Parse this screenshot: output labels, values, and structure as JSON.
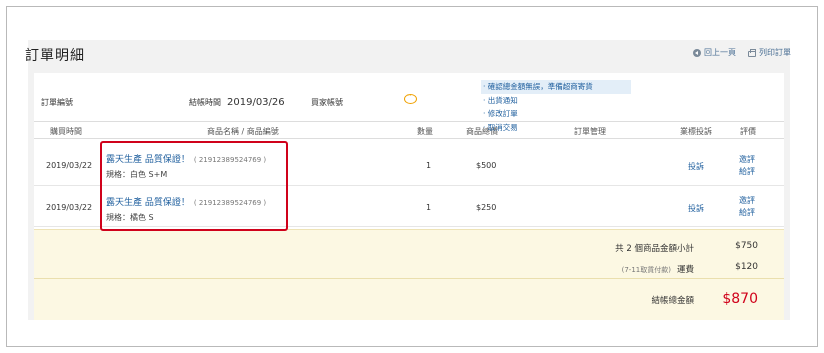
{
  "header": {
    "title": "訂單明細",
    "back_label": "回上一頁",
    "print_label": "列印訂單"
  },
  "order": {
    "number_label": "訂單編號",
    "checkout_time_label": "結帳時間",
    "checkout_time": "2019/03/26",
    "buyer_label": "買家帳號"
  },
  "table": {
    "headers": [
      "購買時間",
      "商品名稱 / 商品編號",
      "數量",
      "商品總價",
      "訂單管理",
      "業標投訴",
      "評價"
    ],
    "rows": [
      {
        "date": "2019/03/22",
        "name": "露天生產 品質保證！",
        "id": "( 21912389524769 )",
        "spec": "規格：白色 S+M",
        "qty": "1",
        "price": "$500",
        "report": "投訴",
        "rate1": "邀評",
        "rate2": "給評"
      },
      {
        "date": "2019/03/22",
        "name": "露天生產 品質保證！",
        "id": "( 21912389524769 )",
        "spec": "規格：橘色 S",
        "qty": "1",
        "price": "$250",
        "report": "投訴",
        "rate1": "邀評",
        "rate2": "給評"
      }
    ],
    "management": [
      "‧ 確認總金額無誤，準備超商寄貨",
      "‧ 出貨通知",
      "‧ 修改訂單",
      "‧ 取消交易"
    ]
  },
  "summary": {
    "subtotal_label": "共 2 個商品金額小計",
    "subtotal": "$750",
    "shipping_note": "(7-11取貨付款)",
    "shipping_label": "運費",
    "shipping": "$120",
    "total_label": "結帳總金額",
    "total": "$870"
  },
  "colors": {
    "accent_red": "#d0021b",
    "link_blue": "#1f5f9e",
    "summary_bg": "#fcf8e3",
    "chat_icon": "#f0a100"
  }
}
